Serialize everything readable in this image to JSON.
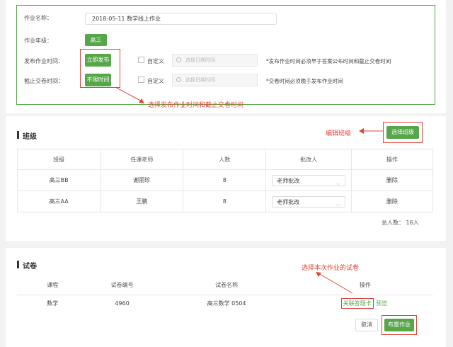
{
  "form": {
    "name_label": "作业名称：",
    "name_value": "2018-05-11  数学线上作业",
    "grade_label": "作业年级：",
    "grade_value": "高三",
    "publish_label": "发布作业时间：",
    "publish_btn": "立即发布",
    "publish_custom": "自定义",
    "publish_placeholder": "选择日期时间",
    "publish_note": "*发布作业时间必须早于答案公布时间和截止交卷时间",
    "deadline_label": "截止交卷时间：",
    "deadline_btn": "不限时间",
    "deadline_custom": "自定义",
    "deadline_placeholder": "选择日期时间",
    "deadline_note": "*交卷时间必须晚于发布作业时间",
    "annotation": "选择发布作业时间和截止交卷时间"
  },
  "classes": {
    "title": "班级",
    "annotation": "编辑班级",
    "select_btn": "选择班级",
    "headers": [
      "班级",
      "任课老师",
      "人数",
      "批改人",
      "操作"
    ],
    "rows": [
      {
        "cls": "高三BB",
        "teacher": "谢丽珍",
        "count": "8",
        "grader": "老师批改",
        "action": "删除"
      },
      {
        "cls": "高三AA",
        "teacher": "王鹏",
        "count": "8",
        "grader": "老师批改",
        "action": "删除"
      }
    ],
    "total": "总人数：  16人"
  },
  "papers": {
    "title": "试卷",
    "annotation": "选择本次作业的试卷",
    "headers": [
      "课程",
      "试卷编号",
      "试卷名称",
      "操作"
    ],
    "row": {
      "course": "数学",
      "id": "4960",
      "name": "高三数学 0504",
      "link1": "关联答题卡",
      "link2": "预览"
    },
    "cancel_btn": "取消",
    "submit_btn": "布置作业"
  },
  "colors": {
    "accent": "#57a64a",
    "annotation": "#e0443a"
  }
}
